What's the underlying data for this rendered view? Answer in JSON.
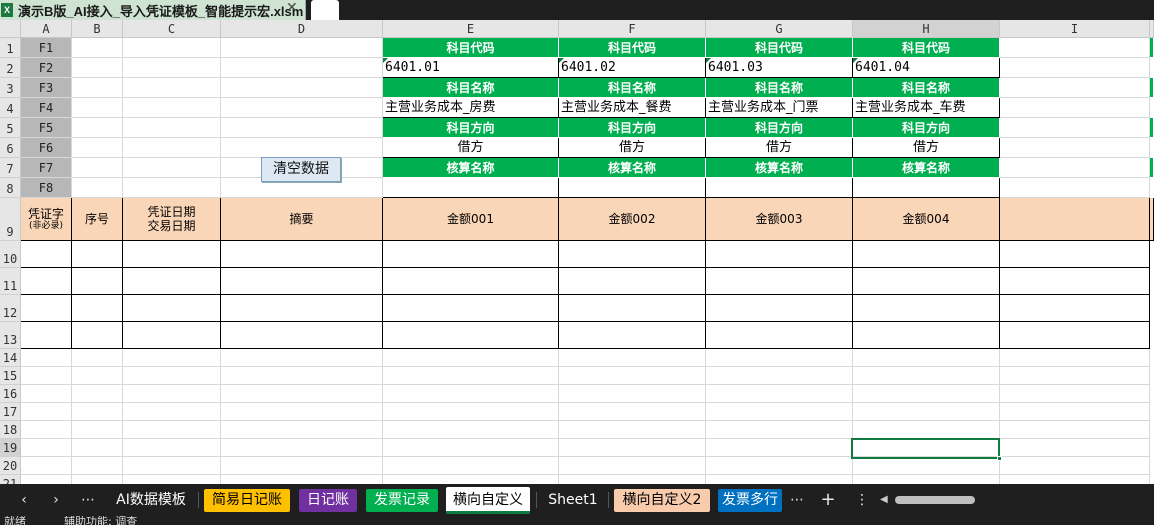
{
  "file_tab": {
    "title": "演示B版_AI接入_导入凭证模板_智能提示宏.xlsm",
    "close": "✕",
    "badge": "X"
  },
  "columns": [
    "A",
    "B",
    "C",
    "D",
    "E",
    "F",
    "G",
    "H",
    "I"
  ],
  "rows": [
    "1",
    "2",
    "3",
    "4",
    "5",
    "6",
    "7",
    "8",
    "9",
    "10",
    "11",
    "12",
    "13",
    "14",
    "15",
    "16",
    "17",
    "18",
    "19",
    "20",
    "21"
  ],
  "a_col": [
    "F1",
    "F2",
    "F3",
    "F4",
    "F5",
    "F6",
    "F7",
    "F8"
  ],
  "labels": {
    "code": "科目代码",
    "name": "科目名称",
    "direction": "科目方向",
    "calc": "核算名称"
  },
  "subjects": [
    {
      "code": "6401.01",
      "name": "主营业务成本_房费",
      "direction": "借方",
      "amount_header": "金额001"
    },
    {
      "code": "6401.02",
      "name": "主营业务成本_餐费",
      "direction": "借方",
      "amount_header": "金额002"
    },
    {
      "code": "6401.03",
      "name": "主营业务成本_门票",
      "direction": "借方",
      "amount_header": "金额003"
    },
    {
      "code": "6401.04",
      "name": "主营业务成本_车费",
      "direction": "借方",
      "amount_header": "金额004"
    }
  ],
  "row9": {
    "voucher": "凭证字",
    "voucher_note": "(非必录)",
    "seq": "序号",
    "date1": "凭证日期",
    "date2": "交易日期",
    "summary": "摘要"
  },
  "button": {
    "clear": "清空数据"
  },
  "sheet_tabs": [
    {
      "label": "AI数据模板",
      "color": ""
    },
    {
      "label": "简易日记账",
      "color": "#ffc000"
    },
    {
      "label": "日记账",
      "color": "#7030a0"
    },
    {
      "label": "发票记录",
      "color": "#00b050"
    },
    {
      "label": "横向自定义",
      "color": "#ffffff",
      "active": true
    },
    {
      "label": "Sheet1",
      "color": ""
    },
    {
      "label": "横向自定义2",
      "color": "#f8cbad"
    },
    {
      "label": "发票多行",
      "color": "#0070c0"
    }
  ],
  "nav": {
    "prev": "‹",
    "next": "›",
    "more": "⋯",
    "add": "+",
    "menu": "⋮"
  },
  "status": {
    "left": "就绪",
    "access": "辅助功能: 调查"
  }
}
